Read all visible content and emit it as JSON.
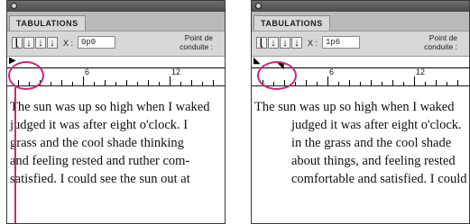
{
  "left": {
    "tab_label": "TABULATIONS",
    "x_label": "X :",
    "x_value": "0p0",
    "lead_label": "Point de conduite :",
    "ruler_labels": [
      "6",
      "12"
    ],
    "text_lines": [
      "The sun was up so high when I waked",
      "judged it was after eight o'clock. I",
      "grass and the cool shade thinking",
      "and feeling rested and ruther com-",
      "satisfied. I could see the sun out at"
    ]
  },
  "right": {
    "tab_label": "TABULATIONS",
    "x_label": "X :",
    "x_value": "1p6",
    "lead_label": "Point de conduite :",
    "ruler_labels": [
      "6",
      "12"
    ],
    "text_lines": [
      "The sun was up so high when I waked",
      "judged it was after eight o'clock.",
      "in the grass and the cool shade",
      "about things, and feeling rested",
      "comfortable and satisfied. I could"
    ]
  },
  "colors": {
    "highlight": "#c8287a",
    "panel_bg": "#d7d7d7"
  },
  "icons": [
    "left-align-tab-icon",
    "center-align-tab-icon",
    "right-align-tab-icon",
    "decimal-align-tab-icon"
  ]
}
